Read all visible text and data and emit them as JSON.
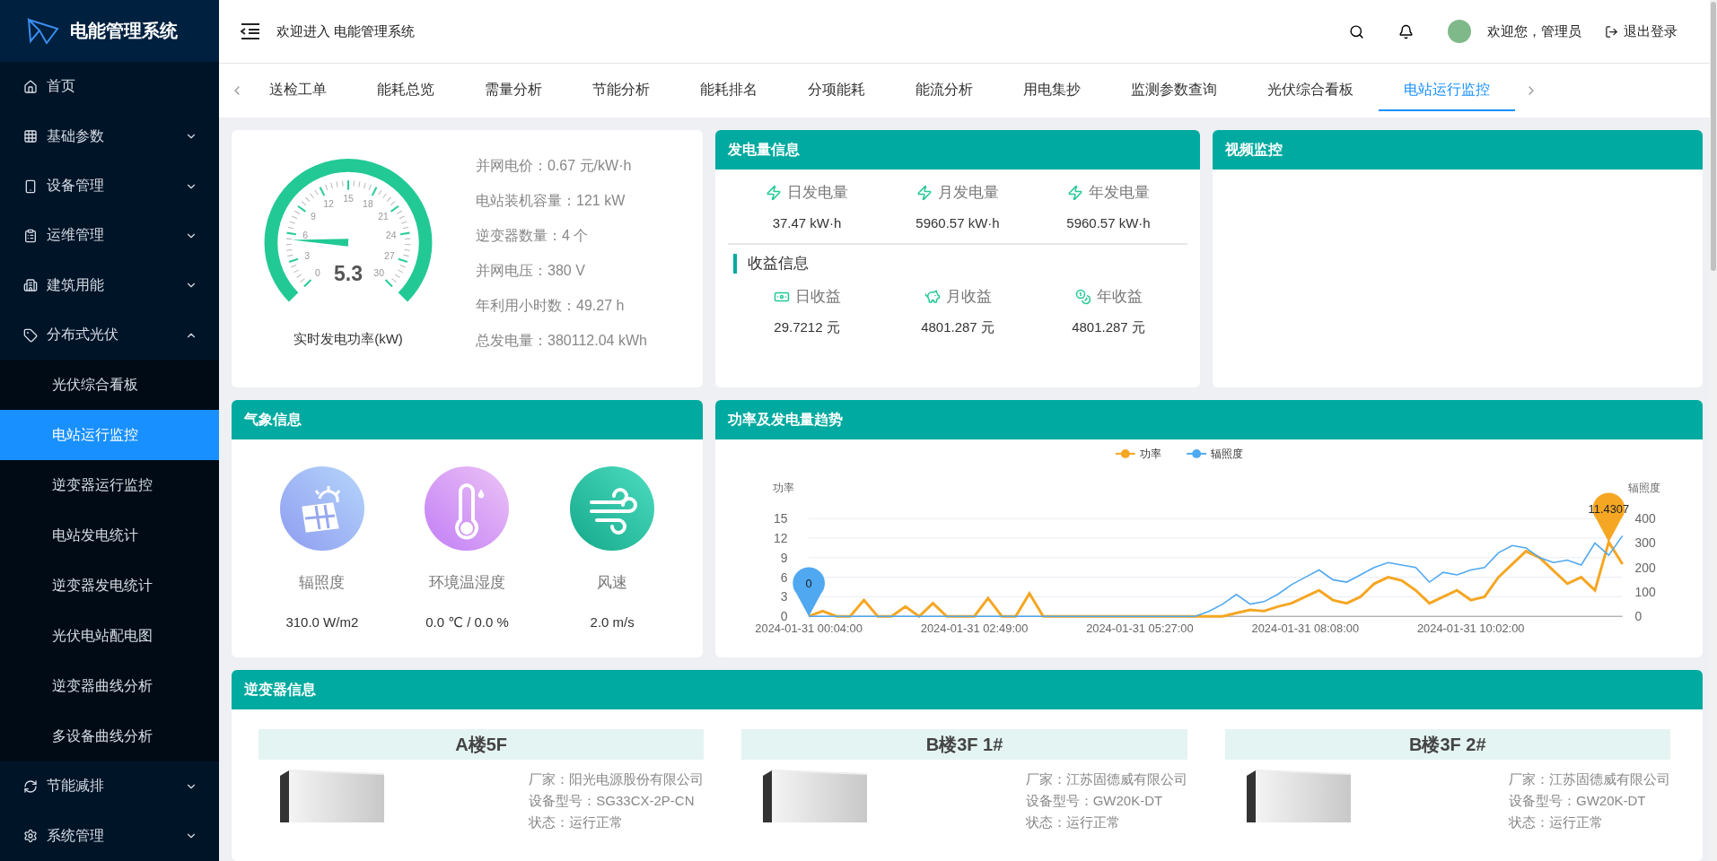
{
  "app": {
    "title": "电能管理系统"
  },
  "sidebar": {
    "items": [
      {
        "label": "首页"
      },
      {
        "label": "基础参数",
        "expanded": false
      },
      {
        "label": "设备管理",
        "expanded": false
      },
      {
        "label": "运维管理",
        "expanded": false
      },
      {
        "label": "建筑用能",
        "expanded": false
      },
      {
        "label": "分布式光伏",
        "expanded": true,
        "children": [
          {
            "label": "光伏综合看板",
            "selected": false
          },
          {
            "label": "电站运行监控",
            "selected": true
          },
          {
            "label": "逆变器运行监控",
            "selected": false
          },
          {
            "label": "电站发电统计",
            "selected": false
          },
          {
            "label": "逆变器发电统计",
            "selected": false
          },
          {
            "label": "光伏电站配电图",
            "selected": false
          },
          {
            "label": "逆变器曲线分析",
            "selected": false
          },
          {
            "label": "多设备曲线分析",
            "selected": false
          }
        ]
      },
      {
        "label": "节能减排",
        "expanded": false
      },
      {
        "label": "系统管理",
        "expanded": false
      }
    ]
  },
  "header": {
    "welcome": "欢迎进入 电能管理系统",
    "user": "欢迎您，管理员",
    "logout": "退出登录"
  },
  "tabs": [
    {
      "label": "送检工单",
      "selected": false
    },
    {
      "label": "能耗总览",
      "selected": false
    },
    {
      "label": "需量分析",
      "selected": false
    },
    {
      "label": "节能分析",
      "selected": false
    },
    {
      "label": "能耗排名",
      "selected": false
    },
    {
      "label": "分项能耗",
      "selected": false
    },
    {
      "label": "能流分析",
      "selected": false
    },
    {
      "label": "用电集抄",
      "selected": false
    },
    {
      "label": "监测参数查询",
      "selected": false
    },
    {
      "label": "光伏综合看板",
      "selected": false
    },
    {
      "label": "电站运行监控",
      "selected": true
    }
  ],
  "gauge": {
    "value": "5.3",
    "ticks": [
      "0",
      "3",
      "6",
      "9",
      "12",
      "15",
      "18",
      "21",
      "24",
      "27",
      "30"
    ],
    "caption": "实时发电功率(kW)"
  },
  "station_info": [
    "并网电价：0.67 元/kW·h",
    "电站装机容量：121 kW",
    "逆变器数量：4 个",
    "并网电压：380 V",
    "年利用小时数：49.27 h",
    "总发电量：380112.04 kWh"
  ],
  "generation": {
    "title": "发电量信息",
    "items": [
      {
        "label": "日发电量",
        "value": "37.47 kW·h"
      },
      {
        "label": "月发电量",
        "value": "5960.57 kW·h"
      },
      {
        "label": "年发电量",
        "value": "5960.57 kW·h"
      }
    ],
    "income_title": "收益信息",
    "income": [
      {
        "label": "日收益",
        "value": "29.7212 元"
      },
      {
        "label": "月收益",
        "value": "4801.287 元"
      },
      {
        "label": "年收益",
        "value": "4801.287 元"
      }
    ]
  },
  "video": {
    "title": "视频监控"
  },
  "weather": {
    "title": "气象信息",
    "items": [
      {
        "label": "辐照度",
        "value": "310.0 W/m2"
      },
      {
        "label": "环境温湿度",
        "value": "0.0 ℃ / 0.0 %"
      },
      {
        "label": "风速",
        "value": "2.0 m/s"
      }
    ]
  },
  "trend": {
    "title": "功率及发电量趋势",
    "chart_data": {
      "type": "line",
      "categories": [
        "2024-01-31 00:04:00",
        null,
        null,
        null,
        null,
        null,
        null,
        null,
        null,
        null,
        null,
        null,
        "2024-01-31 02:49:00",
        null,
        null,
        null,
        null,
        null,
        null,
        null,
        null,
        null,
        null,
        null,
        "2024-01-31 05:27:00",
        null,
        null,
        null,
        null,
        null,
        null,
        null,
        null,
        null,
        null,
        null,
        "2024-01-31 08:08:00",
        null,
        null,
        null,
        null,
        null,
        null,
        null,
        null,
        null,
        null,
        null,
        "2024-01-31 10:02:00",
        null,
        null,
        null,
        null,
        null,
        null,
        null,
        null,
        null,
        null,
        null
      ],
      "grid": true,
      "ylabel": "功率",
      "ylim": [
        0,
        15
      ],
      "yticks": [
        0,
        3,
        6,
        9,
        12,
        15
      ],
      "series": [
        {
          "name": "功率",
          "color": "#f5a623",
          "values": [
            0,
            0.8,
            0,
            0,
            2.5,
            0,
            0,
            1.5,
            0,
            2,
            0,
            0,
            0,
            2.8,
            0,
            0,
            3.5,
            0,
            0,
            0,
            0,
            0,
            0,
            0,
            0,
            0,
            0,
            0,
            0,
            0,
            0,
            0.5,
            1,
            0.8,
            1.5,
            2,
            3,
            4,
            2.5,
            2,
            3,
            5,
            6,
            5.5,
            4,
            2,
            3,
            4,
            2.5,
            3,
            6,
            8,
            10,
            9,
            7,
            5,
            6,
            4,
            11.4,
            8
          ]
        }
      ],
      "annotations": [
        {
          "y": 11.4,
          "text": "11.4307"
        }
      ]
    },
    "irradiance": {
      "chart_data": {
        "type": "line",
        "ylabel": "辐照度",
        "ylim": [
          0,
          400
        ],
        "yticks": [
          0,
          100,
          200,
          300,
          400
        ],
        "series": [
          {
            "name": "辐照度",
            "color": "#4fa8f0",
            "values": [
              0,
              0,
              0,
              0,
              0,
              0,
              0,
              0,
              0,
              0,
              0,
              0,
              0,
              0,
              0,
              0,
              0,
              0,
              0,
              0,
              0,
              0,
              0,
              0,
              0,
              0,
              0,
              0,
              0,
              20,
              50,
              90,
              50,
              60,
              90,
              130,
              160,
              190,
              150,
              140,
              170,
              200,
              220,
              210,
              200,
              140,
              180,
              170,
              190,
              200,
              260,
              290,
              280,
              240,
              220,
              230,
              210,
              300,
              250,
              330
            ]
          }
        ],
        "annotations": [
          {
            "y": 0,
            "text": "0"
          }
        ]
      }
    }
  },
  "inverters": {
    "title": "逆变器信息",
    "items": [
      {
        "name": "A楼5F",
        "vendor": "厂家：阳光电源股份有限公司",
        "model": "设备型号：SG33CX-2P-CN",
        "status": "状态：运行正常"
      },
      {
        "name": "B楼3F 1#",
        "vendor": "厂家：江苏固德威有限公司",
        "model": "设备型号：GW20K-DT",
        "status": "状态：运行正常"
      },
      {
        "name": "B楼3F 2#",
        "vendor": "厂家：江苏固德威有限公司",
        "model": "设备型号：GW20K-DT",
        "status": "状态：运行正常"
      }
    ]
  }
}
